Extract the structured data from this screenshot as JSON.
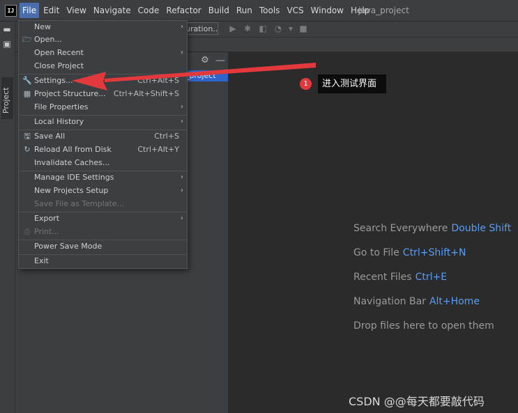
{
  "window": {
    "project_title": "java_project"
  },
  "menubar": {
    "items": [
      {
        "label": "File",
        "active": true
      },
      {
        "label": "Edit"
      },
      {
        "label": "View"
      },
      {
        "label": "Navigate"
      },
      {
        "label": "Code"
      },
      {
        "label": "Refactor"
      },
      {
        "label": "Build"
      },
      {
        "label": "Run"
      },
      {
        "label": "Tools"
      },
      {
        "label": "VCS"
      },
      {
        "label": "Window"
      },
      {
        "label": "Help"
      }
    ]
  },
  "toolbar": {
    "run_config_label": "uration..."
  },
  "sidebar": {
    "project_tab_label": "Project"
  },
  "project_panel": {
    "tree_row_label": "ava_project"
  },
  "file_menu": {
    "items": [
      {
        "label": "New",
        "icon": "none",
        "submenu": true
      },
      {
        "label": "Open...",
        "icon": "folder-open-icon"
      },
      {
        "label": "Open Recent",
        "submenu": true
      },
      {
        "label": "Close Project"
      },
      {
        "label": "Settings...",
        "icon": "wrench-icon",
        "shortcut": "Ctrl+Alt+S"
      },
      {
        "label": "Project Structure...",
        "icon": "project-structure-icon",
        "shortcut": "Ctrl+Alt+Shift+S"
      },
      {
        "label": "File Properties",
        "submenu": true
      },
      {
        "label": "Local History",
        "submenu": true
      },
      {
        "label": "Save All",
        "icon": "save-icon",
        "shortcut": "Ctrl+S"
      },
      {
        "label": "Reload All from Disk",
        "icon": "reload-icon",
        "shortcut": "Ctrl+Alt+Y"
      },
      {
        "label": "Invalidate Caches..."
      },
      {
        "label": "Manage IDE Settings",
        "submenu": true
      },
      {
        "label": "New Projects Setup",
        "submenu": true
      },
      {
        "label": "Save File as Template...",
        "disabled": true
      },
      {
        "label": "Export",
        "submenu": true
      },
      {
        "label": "Print...",
        "icon": "print-icon",
        "disabled": true
      },
      {
        "label": "Power Save Mode"
      },
      {
        "label": "Exit"
      }
    ]
  },
  "editor_hints": [
    {
      "text": "Search Everywhere",
      "key": "Double Shift"
    },
    {
      "text": "Go to File",
      "key": "Ctrl+Shift+N"
    },
    {
      "text": "Recent Files",
      "key": "Ctrl+E"
    },
    {
      "text": "Navigation Bar",
      "key": "Alt+Home"
    },
    {
      "text": "Drop files here to open them",
      "key": ""
    }
  ],
  "annotation": {
    "badge": "1",
    "callout": "进入测试界面"
  },
  "watermark": "CSDN @@每天都要敲代码",
  "colors": {
    "accent": "#589df6",
    "menu_highlight": "#4b6eaf",
    "annotation_red": "#e4393c"
  }
}
